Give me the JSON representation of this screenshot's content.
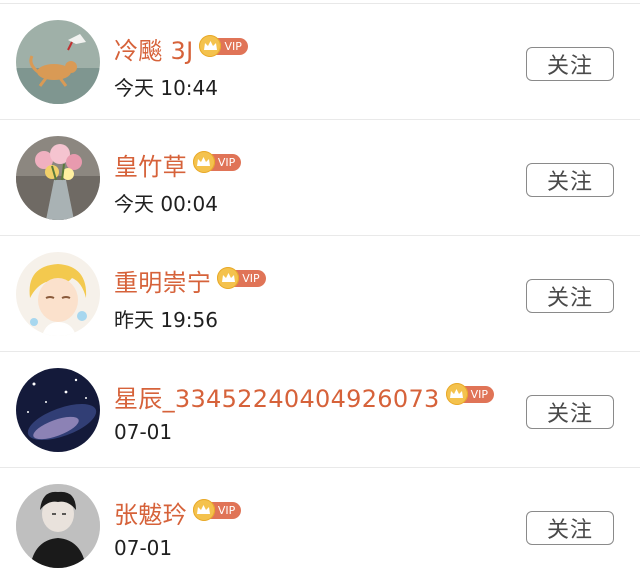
{
  "follow_list": {
    "users": [
      {
        "name": "冷飈 3J",
        "badge": "VIP",
        "time": "今天 10:44",
        "follow_label": "关注",
        "avatar": "cat-chasing-bird"
      },
      {
        "name": "皇竹草",
        "badge": "VIP",
        "time": "今天 00:04",
        "follow_label": "关注",
        "avatar": "flower-bouquet"
      },
      {
        "name": "重明崇宁",
        "badge": "VIP",
        "time": "昨天 19:56",
        "follow_label": "关注",
        "avatar": "anime-boy"
      },
      {
        "name": "星辰_33452240404926073",
        "badge": "VIP",
        "time": "07-01",
        "follow_label": "关注",
        "avatar": "galaxy-nebula"
      },
      {
        "name": "张魃玪",
        "badge": "VIP",
        "time": "07-01",
        "follow_label": "关注",
        "avatar": "portrait-dark"
      }
    ]
  },
  "colors": {
    "name": "#d6623a",
    "vip_tag": "#e07457",
    "vip_crown": "#f4c24d",
    "button_border": "#8a8a8a",
    "divider": "#e9e9e9"
  }
}
